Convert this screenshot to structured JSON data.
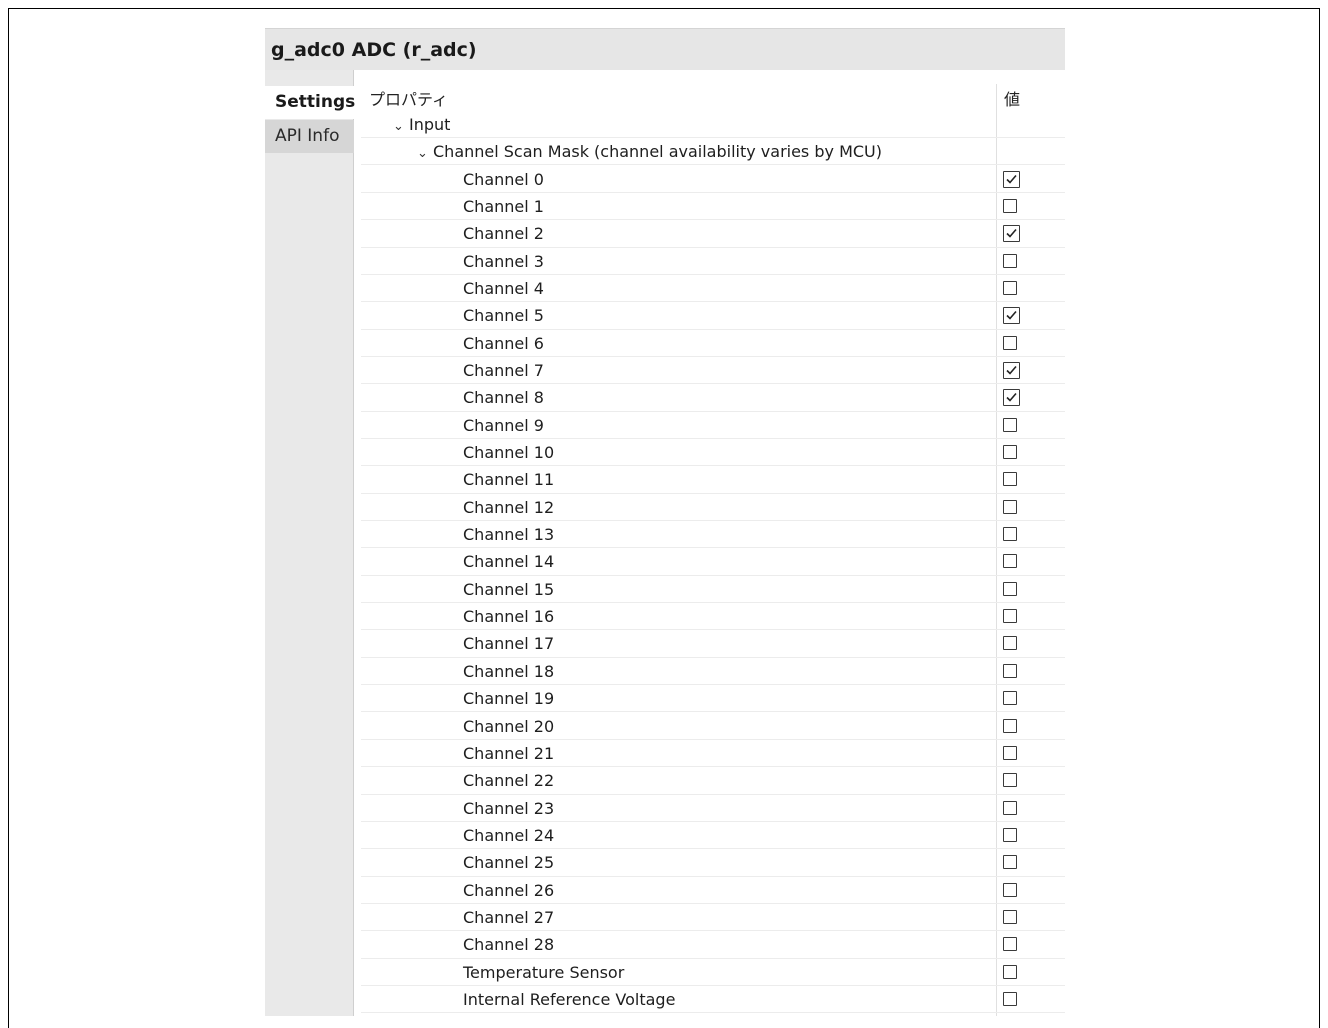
{
  "window": {
    "title": "g_adc0 ADC (r_adc)"
  },
  "tabs": [
    {
      "label": "Settings",
      "active": true
    },
    {
      "label": "API Info",
      "active": false
    }
  ],
  "table": {
    "columns": {
      "property": "プロパティ",
      "value": "値"
    },
    "group": {
      "label": "Input",
      "expanded": true
    },
    "subgroup": {
      "label": "Channel Scan Mask (channel availability varies by MCU)",
      "expanded": true
    },
    "items": [
      {
        "label": "Channel 0",
        "checked": true
      },
      {
        "label": "Channel 1",
        "checked": false
      },
      {
        "label": "Channel 2",
        "checked": true
      },
      {
        "label": "Channel 3",
        "checked": false
      },
      {
        "label": "Channel 4",
        "checked": false
      },
      {
        "label": "Channel 5",
        "checked": true
      },
      {
        "label": "Channel 6",
        "checked": false
      },
      {
        "label": "Channel 7",
        "checked": true
      },
      {
        "label": "Channel 8",
        "checked": true
      },
      {
        "label": "Channel 9",
        "checked": false
      },
      {
        "label": "Channel 10",
        "checked": false
      },
      {
        "label": "Channel 11",
        "checked": false
      },
      {
        "label": "Channel 12",
        "checked": false
      },
      {
        "label": "Channel 13",
        "checked": false
      },
      {
        "label": "Channel 14",
        "checked": false
      },
      {
        "label": "Channel 15",
        "checked": false
      },
      {
        "label": "Channel 16",
        "checked": false
      },
      {
        "label": "Channel 17",
        "checked": false
      },
      {
        "label": "Channel 18",
        "checked": false
      },
      {
        "label": "Channel 19",
        "checked": false
      },
      {
        "label": "Channel 20",
        "checked": false
      },
      {
        "label": "Channel 21",
        "checked": false
      },
      {
        "label": "Channel 22",
        "checked": false
      },
      {
        "label": "Channel 23",
        "checked": false
      },
      {
        "label": "Channel 24",
        "checked": false
      },
      {
        "label": "Channel 25",
        "checked": false
      },
      {
        "label": "Channel 26",
        "checked": false
      },
      {
        "label": "Channel 27",
        "checked": false
      },
      {
        "label": "Channel 28",
        "checked": false
      },
      {
        "label": "Temperature Sensor",
        "checked": false
      },
      {
        "label": "Internal Reference Voltage",
        "checked": false
      }
    ]
  }
}
